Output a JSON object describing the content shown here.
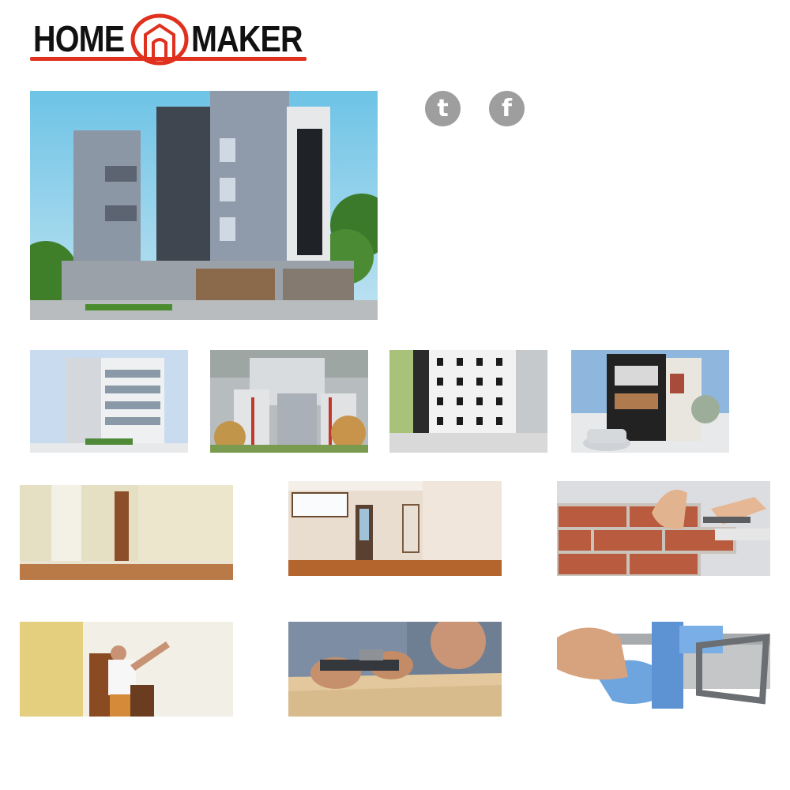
{
  "brand": {
    "word_left": "HOME",
    "word_right": "MAKER",
    "accent_color": "#e0301e"
  },
  "social": [
    {
      "icon": "twitter-icon",
      "glyph": "t"
    },
    {
      "icon": "facebook-icon",
      "glyph": "f"
    }
  ],
  "hero_image": {
    "depicts": "modern-apartment-building"
  },
  "project_thumbnails": [
    {
      "depicts": "white-apartment-building"
    },
    {
      "depicts": "housing-complex"
    },
    {
      "depicts": "tall-apartment-tower"
    },
    {
      "depicts": "townhouse-with-car"
    }
  ],
  "service_images": [
    {
      "depicts": "empty-room-interior"
    },
    {
      "depicts": "empty-living-room"
    },
    {
      "depicts": "bricklaying"
    },
    {
      "depicts": "wall-painting"
    },
    {
      "depicts": "carpentry-hand-plane"
    },
    {
      "depicts": "pvc-plumbing-pipe"
    }
  ]
}
